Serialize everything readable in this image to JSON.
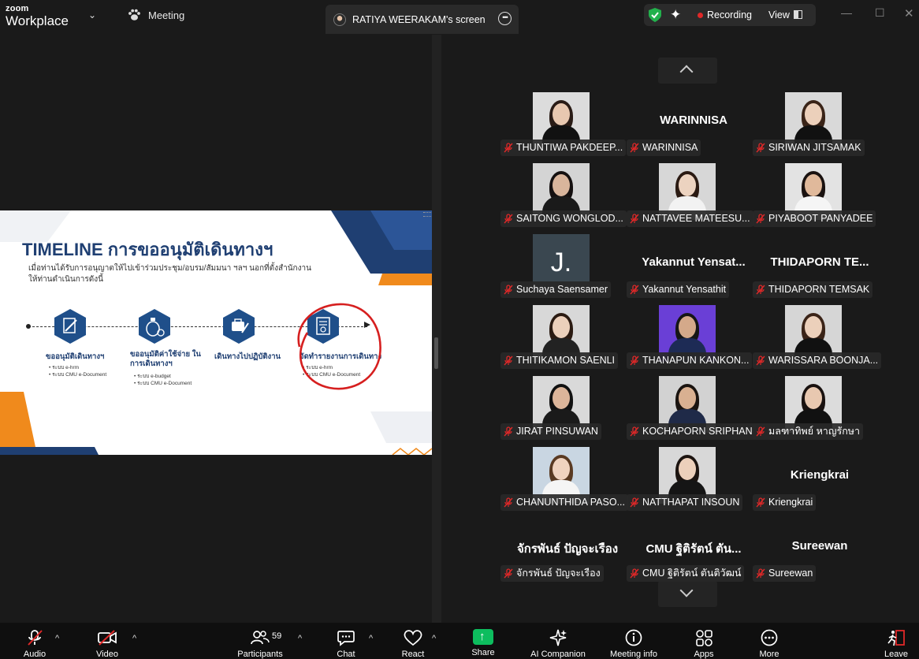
{
  "app": {
    "brand_top": "zoom",
    "brand_bottom": "Workplace"
  },
  "tabs": {
    "meeting": "Meeting",
    "screen": "RATIYA WEERAKAM's screen"
  },
  "status": {
    "recording": "Recording",
    "view": "View"
  },
  "slide": {
    "title": "TIMELINE การขออนุมัติเดินทางฯ",
    "subtitle": "เมื่อท่านได้รับการอนุญาตให้ไปเข้าร่วมประชุม/อบรม/สัมมนา ฯลฯ นอกที่ตั้งสำนักงาน ให้ท่านดำเนินการดังนี้",
    "steps": [
      {
        "title": "ขออนุมัติเดินทางฯ",
        "items": [
          "• ระบบ e-hrm",
          "• ระบบ CMU e-Document"
        ]
      },
      {
        "title": "ขออนุมัติค่าใช้จ่าย ในการเดินทางฯ",
        "items": [
          "• ระบบ e-budget",
          "• ระบบ CMU e-Document"
        ]
      },
      {
        "title": "เดินทางไปปฏิบัติงาน",
        "items": []
      },
      {
        "title": "จัดทำรายงานการเดินทาง",
        "items": [
          "• ระบบ e-hrm",
          "• ระบบ CMU e-Document"
        ]
      }
    ]
  },
  "participants": [
    {
      "tag": "THUNTIWA PAKDEEP...",
      "big": ""
    },
    {
      "tag": "WARINNISA",
      "big": "WARINNISA"
    },
    {
      "tag": "SIRIWAN JITSAMAK",
      "big": ""
    },
    {
      "tag": "SAITONG WONGLOD...",
      "big": ""
    },
    {
      "tag": "NATTAVEE MATEESU...",
      "big": ""
    },
    {
      "tag": "PIYABOOT PANYADEE",
      "big": ""
    },
    {
      "tag": "Suchaya Saensamer",
      "big": "",
      "initial": "J."
    },
    {
      "tag": "Yakannut Yensathit",
      "big": "Yakannut  Yensat..."
    },
    {
      "tag": "THIDAPORN TEMSAK",
      "big": "THIDAPORN  TE..."
    },
    {
      "tag": "THITIKAMON SAENLI",
      "big": ""
    },
    {
      "tag": "THANAPUN KANKON...",
      "big": ""
    },
    {
      "tag": "WARISSARA BOONJA...",
      "big": ""
    },
    {
      "tag": "JIRAT PINSUWAN",
      "big": ""
    },
    {
      "tag": "KOCHAPORN SRIPHAN",
      "big": ""
    },
    {
      "tag": "มลฑาทิพย์ หาญรักษา",
      "big": ""
    },
    {
      "tag": "CHANUNTHIDA PASO...",
      "big": ""
    },
    {
      "tag": "NATTHAPAT INSOUN",
      "big": ""
    },
    {
      "tag": "Kriengkrai",
      "big": "Kriengkrai"
    },
    {
      "tag": "จักรพันธ์ ปัญจะเรือง",
      "big": "จักรพันธ์  ปัญจะเรือง"
    },
    {
      "tag": "CMU ฐิติรัตน์ ตันติวัฒน์",
      "big": "CMU  ฐิติรัตน์  ตัน..."
    },
    {
      "tag": "Sureewan",
      "big": "Sureewan"
    }
  ],
  "toolbar": {
    "audio": "Audio",
    "video": "Video",
    "participants": "Participants",
    "participants_count": "59",
    "chat": "Chat",
    "react": "React",
    "share": "Share",
    "ai": "AI Companion",
    "meeting_info": "Meeting info",
    "apps": "Apps",
    "more": "More",
    "leave": "Leave"
  },
  "colors": {
    "accent_green": "#0dbd5e",
    "record_red": "#e02828",
    "slide_navy": "#1f3f72",
    "slide_orange": "#f08a1c"
  }
}
